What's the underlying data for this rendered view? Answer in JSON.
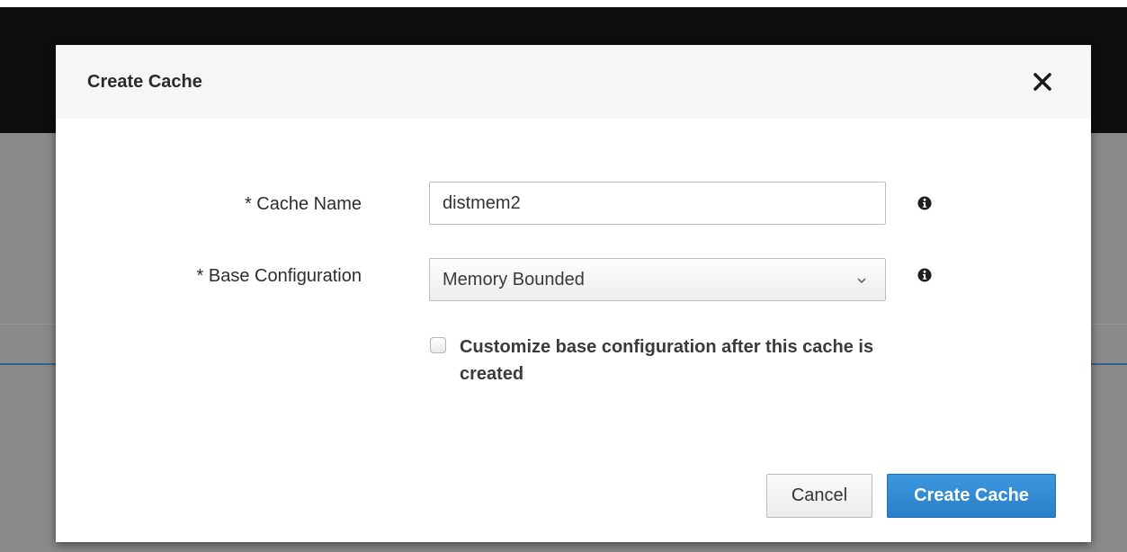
{
  "dialog": {
    "title": "Create Cache",
    "close_icon": "close-icon"
  },
  "form": {
    "cache_name": {
      "label": "* Cache Name",
      "value": "distmem2",
      "info_icon": "info-icon"
    },
    "base_configuration": {
      "label": "* Base Configuration",
      "selected": "Memory Bounded",
      "chevron_icon": "chevron-down-icon",
      "info_icon": "info-icon"
    },
    "customize_checkbox": {
      "label": "Customize base configuration after this cache is created",
      "checked": false
    }
  },
  "buttons": {
    "cancel": "Cancel",
    "create": "Create Cache"
  },
  "colors": {
    "primary": "#2a7fc9",
    "header_bg": "#f6f6f6",
    "backdrop": "#8a8a8a",
    "topbar": "#0e0e0e"
  }
}
